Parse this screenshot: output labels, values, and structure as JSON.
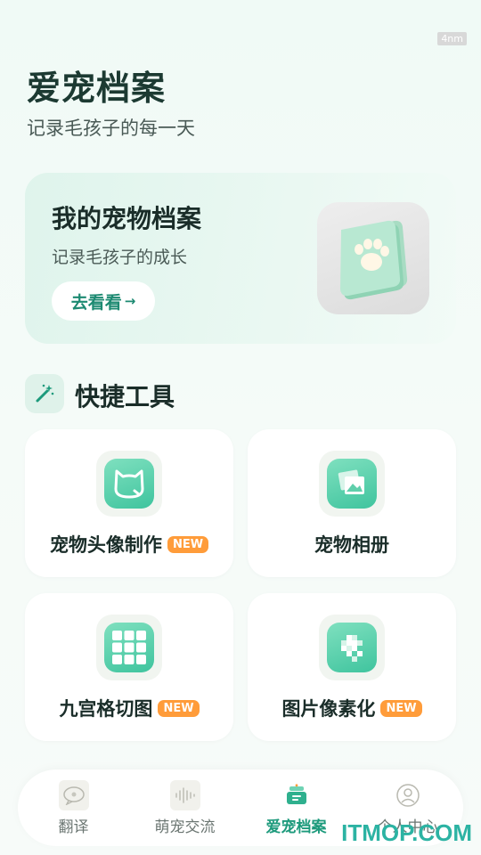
{
  "watermark_top": "4nm",
  "header": {
    "title": "爱宠档案",
    "subtitle": "记录毛孩子的每一天"
  },
  "hero": {
    "title": "我的宠物档案",
    "subtitle": "记录毛孩子的成长",
    "button_label": "去看看",
    "button_icon": "arrow-right-icon",
    "image_icon": "paw-book-icon"
  },
  "quick_tools": {
    "title": "快捷工具",
    "icon": "magic-wand-icon",
    "items": [
      {
        "label": "宠物头像制作",
        "badge": "NEW",
        "icon": "cat-avatar-icon"
      },
      {
        "label": "宠物相册",
        "badge": "",
        "icon": "photo-album-icon"
      },
      {
        "label": "九宫格切图",
        "badge": "NEW",
        "icon": "nine-grid-icon"
      },
      {
        "label": "图片像素化",
        "badge": "NEW",
        "icon": "pixelate-icon"
      }
    ]
  },
  "nav": {
    "items": [
      {
        "label": "翻译",
        "icon": "translate-icon",
        "active": false
      },
      {
        "label": "萌宠交流",
        "icon": "soundwave-icon",
        "active": false
      },
      {
        "label": "爱宠档案",
        "icon": "archive-icon",
        "active": true
      },
      {
        "label": "个人中心",
        "icon": "profile-icon",
        "active": false
      }
    ]
  },
  "watermark_bottom": "ITMOP.COM",
  "colors": {
    "accent": "#1d9a7c",
    "badge": "#ff9c3a",
    "icon_green": "#3fc49e"
  }
}
